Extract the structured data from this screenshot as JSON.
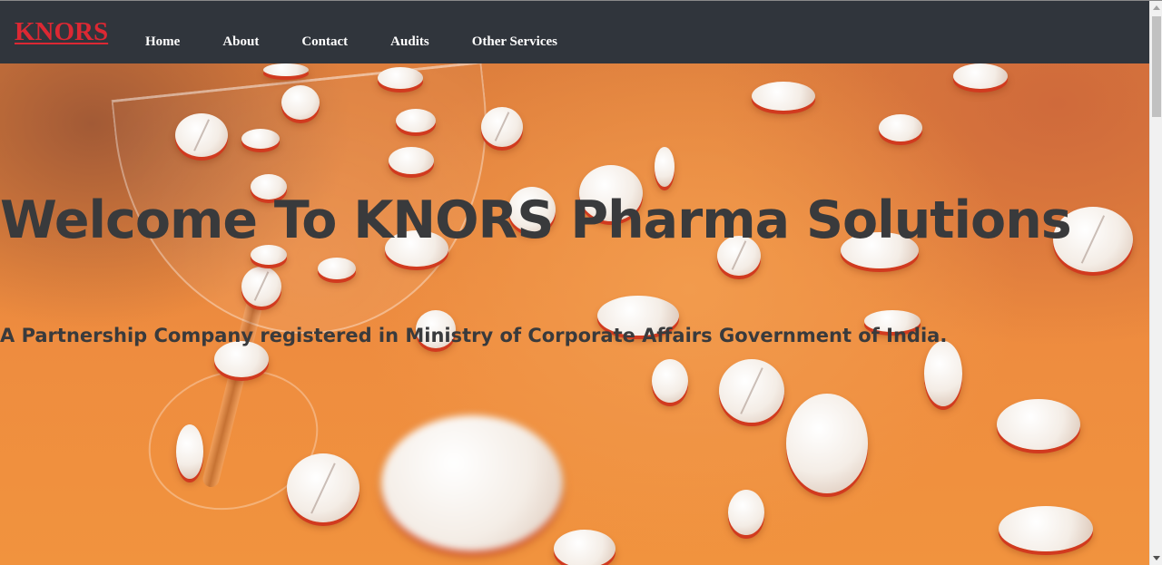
{
  "navbar": {
    "brand": "KNORS",
    "links": {
      "home": "Home",
      "about": "About",
      "contact": "Contact",
      "audits": "Audits",
      "other_services": "Other Services"
    }
  },
  "hero": {
    "title": "Welcome To KNORS Pharma Solutions",
    "subtitle": "A Partnership Company registered in Ministry of Corporate Affairs Government of India."
  },
  "colors": {
    "navbar_bg": "#30353c",
    "brand": "#dc2833",
    "hero_orange": "#ee8c3f",
    "hero_text": "#393a3c"
  },
  "scrollbar": {
    "position_fraction": 0.0
  }
}
